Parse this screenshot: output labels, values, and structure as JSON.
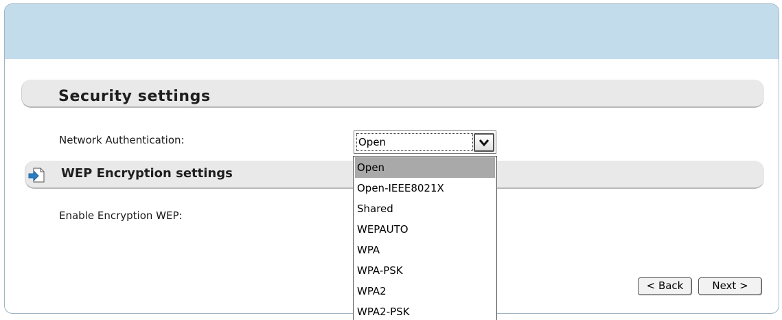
{
  "security_section": {
    "title": "Security settings",
    "network_auth_label": "Network Authentication:",
    "network_auth_value": "Open",
    "network_auth_options": [
      "Open",
      "Open-IEEE8021X",
      "Shared",
      "WEPAUTO",
      "WPA",
      "WPA-PSK",
      "WPA2",
      "WPA2-PSK"
    ],
    "highlighted_option": "Open"
  },
  "wep_section": {
    "title": "WEP Encryption settings",
    "icon": "page-arrow-icon",
    "enable_label": "Enable Encryption WEP:"
  },
  "buttons": {
    "back": "< Back",
    "next": "Next >"
  },
  "colors": {
    "header": "#c2dcec",
    "section_bar": "#e9e9e9",
    "highlight": "#a9a9a9",
    "icon_arrow": "#2a7fc4"
  }
}
